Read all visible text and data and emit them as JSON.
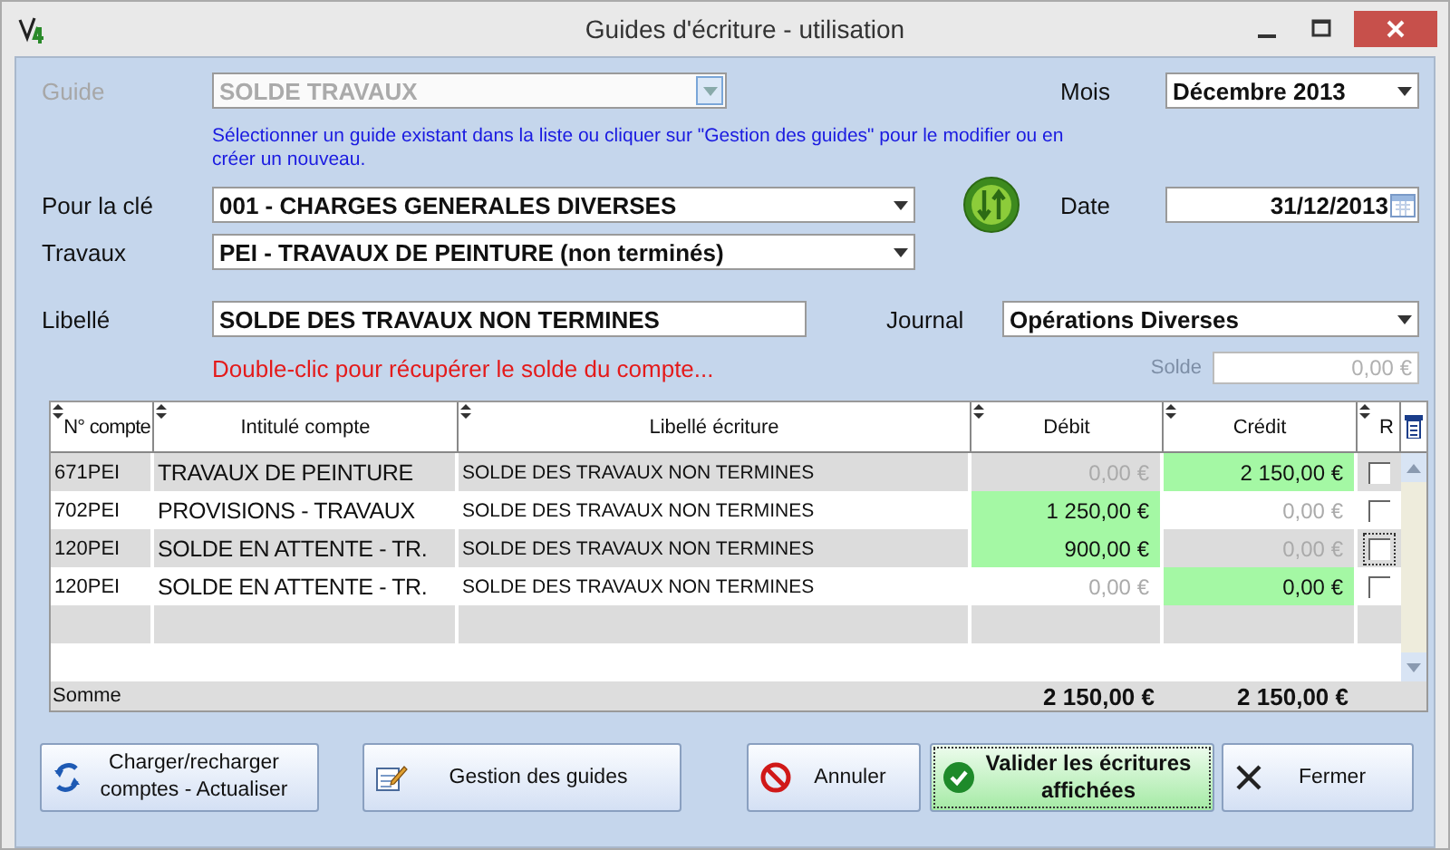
{
  "window": {
    "title": "Guides d'écriture - utilisation"
  },
  "guide": {
    "label": "Guide",
    "value": "SOLDE TRAVAUX",
    "disabled": true
  },
  "mois": {
    "label": "Mois",
    "value": "Décembre 2013"
  },
  "hint": "Sélectionner un guide existant dans la liste ou cliquer sur \"Gestion des guides\" pour le modifier ou en créer un nouveau.",
  "cle": {
    "label": "Pour la clé",
    "value": "001 - CHARGES GENERALES DIVERSES"
  },
  "date": {
    "label": "Date",
    "value": "31/12/2013"
  },
  "travaux": {
    "label": "Travaux",
    "value": "PEI - TRAVAUX DE  PEINTURE (non terminés)"
  },
  "libelle": {
    "label": "Libellé",
    "value": "SOLDE DES TRAVAUX NON TERMINES"
  },
  "journal": {
    "label": "Journal",
    "value": "Opérations Diverses"
  },
  "double_click_hint": "Double-clic pour récupérer le solde du compte...",
  "solde": {
    "label": "Solde",
    "value": "0,00 €",
    "disabled": true
  },
  "table": {
    "columns": [
      "N° compte",
      "Intitulé compte",
      "Libellé écriture",
      "Débit",
      "Crédit",
      "R"
    ],
    "rows": [
      {
        "compte": "671PEI",
        "intitule": "TRAVAUX DE  PEINTURE",
        "libelle": "SOLDE DES TRAVAUX NON TERMINES",
        "debit": {
          "value": "0,00 €",
          "highlighted": false
        },
        "credit": {
          "value": "2 150,00 €",
          "highlighted": true
        },
        "r": {
          "checked": false,
          "focused": false
        }
      },
      {
        "compte": "702PEI",
        "intitule": "PROVISIONS - TRAVAUX",
        "libelle": "SOLDE DES TRAVAUX NON TERMINES",
        "debit": {
          "value": "1 250,00 €",
          "highlighted": true
        },
        "credit": {
          "value": "0,00 €",
          "highlighted": false
        },
        "r": {
          "checked": false,
          "focused": false
        }
      },
      {
        "compte": "120PEI",
        "intitule": "SOLDE EN ATTENTE - TR.",
        "libelle": "SOLDE DES TRAVAUX NON TERMINES",
        "debit": {
          "value": "900,00 €",
          "highlighted": true
        },
        "credit": {
          "value": "0,00 €",
          "highlighted": false
        },
        "r": {
          "checked": false,
          "focused": true
        }
      },
      {
        "compte": "120PEI",
        "intitule": "SOLDE EN ATTENTE - TR.",
        "libelle": "SOLDE DES TRAVAUX NON TERMINES",
        "debit": {
          "value": "0,00 €",
          "highlighted": false
        },
        "credit": {
          "value": "0,00 €",
          "highlighted": true
        },
        "r": {
          "checked": false,
          "focused": false
        }
      }
    ],
    "sum": {
      "label": "Somme",
      "debit": "2 150,00 €",
      "credit": "2 150,00 €"
    }
  },
  "buttons": [
    {
      "label": "Charger/recharger comptes - Actualiser",
      "kind": "refresh",
      "primary": false
    },
    {
      "label": "Gestion des guides",
      "kind": "edit",
      "primary": false
    },
    {
      "label": "Annuler",
      "kind": "cancel",
      "primary": false
    },
    {
      "label": "Valider les écritures affichées",
      "kind": "validate",
      "primary": true
    },
    {
      "label": "Fermer",
      "kind": "close",
      "primary": false
    }
  ]
}
